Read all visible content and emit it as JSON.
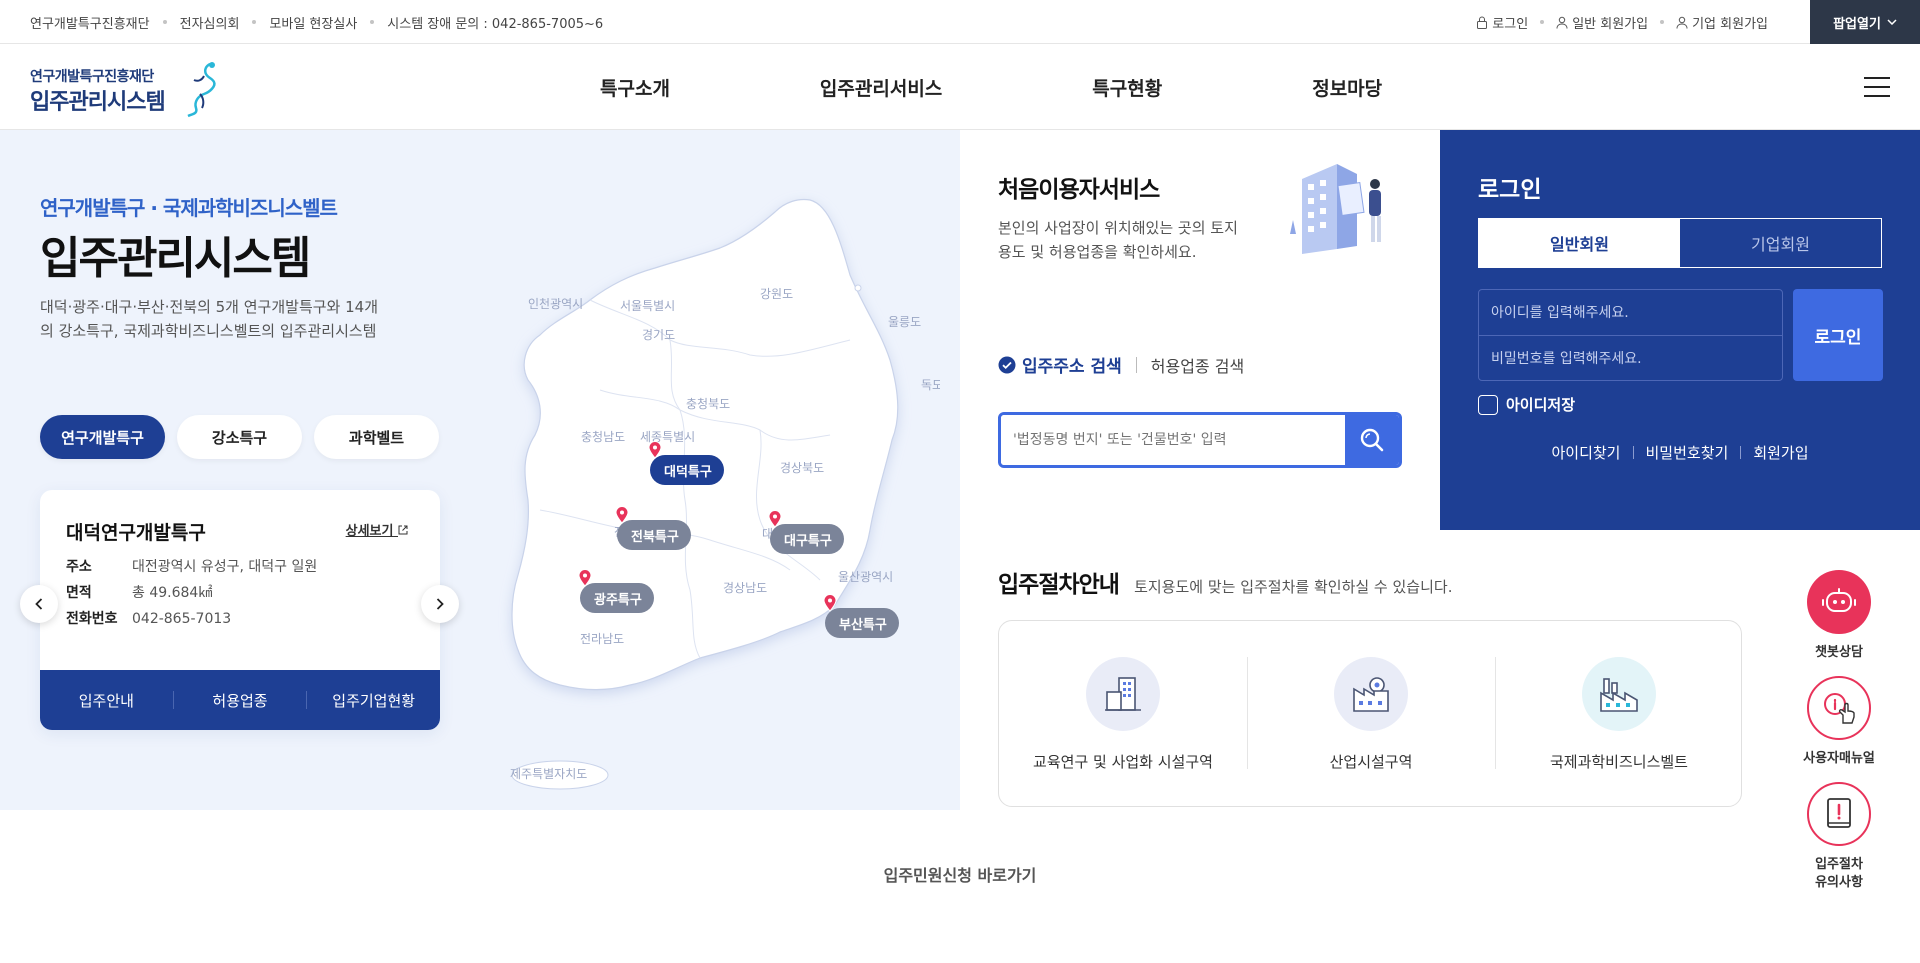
{
  "topbar": {
    "links": [
      "연구개발특구진흥재단",
      "전자심의회",
      "모바일 현장실사",
      "시스템 장애 문의 : 042-865-7005~6"
    ],
    "login": "로그인",
    "join_personal": "일반 회원가입",
    "join_company": "기업 회원가입",
    "popup": "팝업열기"
  },
  "logo": {
    "line1": "연구개발특구진흥재단",
    "line2": "입주관리시스템"
  },
  "nav": [
    "특구소개",
    "입주관리서비스",
    "특구현황",
    "정보마당"
  ],
  "hero": {
    "subtitle": "연구개발특구 · 국제과학비즈니스벨트",
    "title": "입주관리시스템",
    "desc": "대덕·광주·대구·부산·전북의 5개 연구개발특구와 14개의 강소특구, 국제과학비즈니스벨트의 입주관리시스템",
    "tabs": [
      "연구개발특구",
      "강소특구",
      "과학벨트"
    ],
    "card": {
      "title": "대덕연구개발특구",
      "more": "상세보기",
      "address_label": "주소",
      "address": "대전광역시 유성구, 대덕구 일원",
      "area_label": "면적",
      "area": "총 49.684㎢",
      "phone_label": "전화번호",
      "phone": "042-865-7013",
      "buttons": [
        "입주안내",
        "허용업종",
        "입주기업현황"
      ]
    }
  },
  "map": {
    "regions": [
      "인천광역시",
      "서울특별시",
      "경기도",
      "강원도",
      "울릉도",
      "독도",
      "충청북도",
      "충청남도",
      "세종특별시",
      "경상북도",
      "전라남도",
      "경상남도",
      "울산광역시",
      "제주특별자치도",
      "전",
      "대"
    ],
    "pins": [
      "대덕특구",
      "전북특구",
      "대구특구",
      "광주특구",
      "부산특구"
    ]
  },
  "first_user": {
    "title": "처음이용자서비스",
    "desc": "본인의 사업장이 위치해있는 곳의 토지용도 및 허용업종을 확인하세요.",
    "tab_active": "입주주소 검색",
    "tab_other": "허용업종 검색",
    "search_placeholder": "'법정동명 번지' 또는 '건물번호' 입력"
  },
  "login": {
    "title": "로그인",
    "tab_personal": "일반회원",
    "tab_company": "기업회원",
    "id_placeholder": "아이디를 입력해주세요.",
    "pw_placeholder": "비밀번호를 입력해주세요.",
    "button": "로그인",
    "save_id": "아이디저장",
    "links": [
      "아이디찾기",
      "비밀번호찾기",
      "회원가입"
    ]
  },
  "procedure": {
    "title": "입주절차안내",
    "desc": "토지용도에 맞는 입주절차를 확인하실 수 있습니다.",
    "items": [
      "교육연구 및 사업화 시설구역",
      "산업시설구역",
      "국제과학비즈니스벨트"
    ]
  },
  "bottom_link": "입주민원신청 바로가기",
  "floating": {
    "chatbot": "챗봇상담",
    "manual": "사용자매뉴얼",
    "caution": "입주절차 유의사항"
  },
  "colors": {
    "primary": "#1e3f94",
    "accent": "#3e6ae1",
    "floating": "#e8335a",
    "hero_bg": "#eef3fc"
  }
}
